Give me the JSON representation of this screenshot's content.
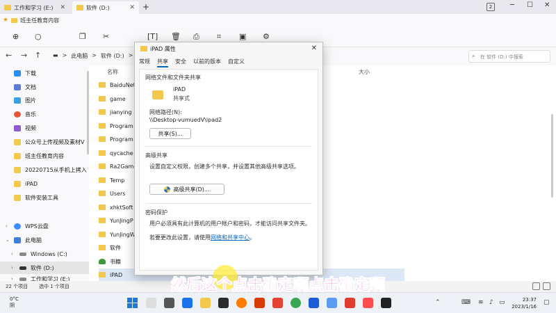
{
  "tabs": [
    {
      "label": "工作和学习 (E:)",
      "active": false
    },
    {
      "label": "软件 (D:)",
      "active": true
    }
  ],
  "window": {
    "count": "2"
  },
  "favorites": {
    "item": "班主任教育内容"
  },
  "address": {
    "crumbs": [
      "此电脑",
      ">",
      "软件 (D:)",
      ">"
    ],
    "search_placeholder": "在 软件 (D:) 中搜索"
  },
  "sidebar": {
    "items": [
      {
        "label": "下载",
        "color": "#2c8cf0"
      },
      {
        "label": "文档",
        "color": "#5a7bd6"
      },
      {
        "label": "图片",
        "color": "#3aa1e6"
      },
      {
        "label": "音乐",
        "color": "#e8563a"
      },
      {
        "label": "视频",
        "color": "#8d5bd6"
      },
      {
        "label": "公众号上传视频及素材V",
        "color": "#f2c94c"
      },
      {
        "label": "班主任教育内容",
        "color": "#f2c94c"
      },
      {
        "label": "20220715从手机上拷入",
        "color": "#f2c94c"
      },
      {
        "label": "iPAD",
        "color": "#f2c94c"
      },
      {
        "label": "软件安装工具",
        "color": "#f2c94c"
      },
      {
        "label": "WPS云盘",
        "color": "#3f8cff"
      },
      {
        "label": "此电脑",
        "color": "#3f7fd6"
      },
      {
        "label": "Windows (C:)",
        "color": "#8a8a8a"
      },
      {
        "label": "软件 (D:)",
        "color": "#333333"
      },
      {
        "label": "工作和学习 (E:)",
        "color": "#8a8a8a"
      }
    ]
  },
  "filelist": {
    "columns": [
      "名称",
      "大小"
    ],
    "rows": [
      "BaiduNet",
      "game",
      "jianying",
      "Program",
      "Program",
      "qycache",
      "Ra2Game",
      "Temp",
      "Users",
      "xhktSoft",
      "YunJingP",
      "YunJingW",
      "软件",
      "书籍",
      "iPAD"
    ]
  },
  "status": {
    "count": "22 个项目",
    "selected": "选中 1 个项目"
  },
  "dialog": {
    "title": "iPAD 属性",
    "tabs": [
      "常规",
      "共享",
      "安全",
      "以前的版本",
      "自定义"
    ],
    "network_group": "网络文件和文件夹共享",
    "folder_name": "iPAD",
    "share_state": "共享式",
    "netpath_label": "网络路径(N):",
    "netpath_value": "\\\\Desktop-vumuedV\\ipad2",
    "share_button": "共享(S)...",
    "advanced_group": "高级共享",
    "advanced_desc": "设置自定义权限，创建多个共享，并设置其他高级共享选项。",
    "advanced_button": "高级共享(D)...",
    "password_group": "密码保护",
    "password_desc": "用户必须具有此计算机的用户帐户和密码，才能访问共享文件夹。",
    "password_change_prefix": "若要更改此设置，请使用",
    "password_change_link": "网络和共享中心",
    "password_change_suffix": "。"
  },
  "subtitle": "然后这个点击确定啊点击确定啊",
  "taskbar": {
    "temp": "0°C",
    "weather": "阴",
    "time": "23:37",
    "date": "2023/1/16"
  }
}
